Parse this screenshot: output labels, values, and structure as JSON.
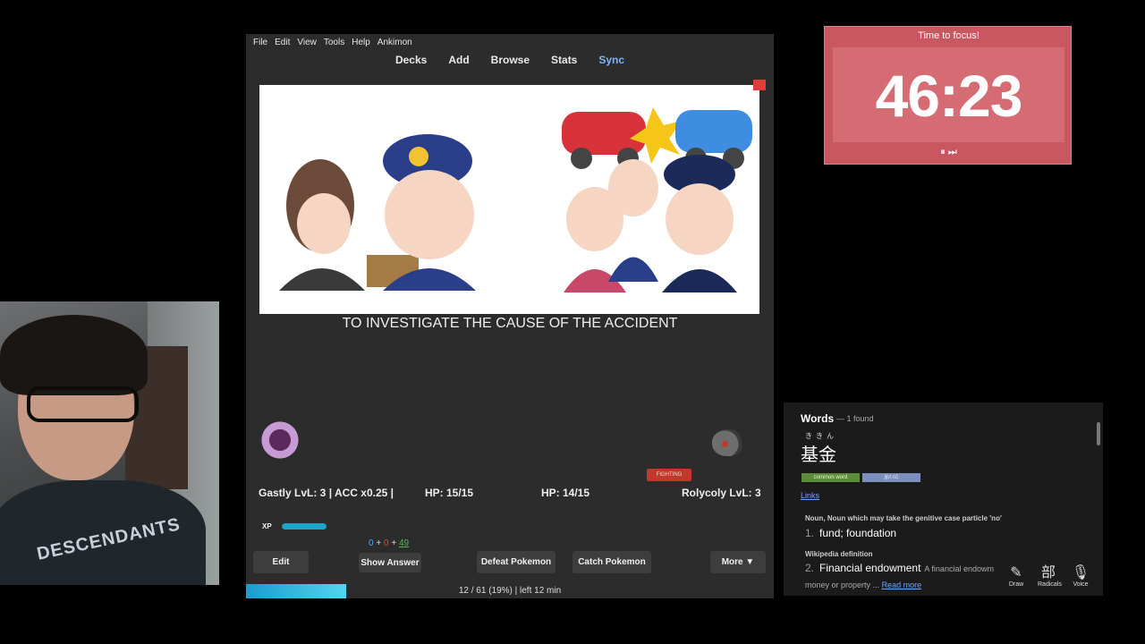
{
  "menubar": [
    "File",
    "Edit",
    "View",
    "Tools",
    "Help",
    "Ankimon"
  ],
  "toolbar": {
    "decks": "Decks",
    "add": "Add",
    "browse": "Browse",
    "stats": "Stats",
    "sync": "Sync"
  },
  "card": {
    "answer": "TO INVESTIGATE THE CAUSE OF THE ACCIDENT"
  },
  "battle": {
    "player": "Gastly LvL: 3 | ACC x0.25 |",
    "player_hp": "HP: 15/15",
    "enemy_hp": "HP: 14/15",
    "enemy": "Rolycoly LvL: 3",
    "enemy_type": "FIGHTING",
    "xp_label": "XP",
    "xp_fraction": 0.55
  },
  "counts": {
    "new": "0",
    "plus1": "+",
    "learn": "0",
    "plus2": "+",
    "review": "49"
  },
  "buttons": {
    "edit": "Edit",
    "show_answer": "Show Answer",
    "defeat": "Defeat Pokemon",
    "catch": "Catch Pokemon",
    "more": "More ▼"
  },
  "progress": {
    "text": "12 / 61 (19%) | left 12 min",
    "fraction": 0.19
  },
  "timer": {
    "title": "Time to focus!",
    "time": "46:23",
    "controls": "⏸ ⏭"
  },
  "dictionary": {
    "title": "Words",
    "count": "— 1 found",
    "furigana": "ききん",
    "word": "基金",
    "tags": [
      "common word",
      "jlpt n1"
    ],
    "links": "Links",
    "pos": "Noun, Noun which may take the genitive case particle 'no'",
    "def1_num": "1.",
    "def1": "fund; foundation",
    "wiki_header": "Wikipedia definition",
    "def2_num": "2.",
    "def2": "Financial endowment",
    "def2_extra": "A financial endowm",
    "def2_cont": "money or property ...",
    "read_more": "Read more",
    "tools": [
      {
        "icon": "✎",
        "label": "Draw"
      },
      {
        "icon": "部",
        "label": "Radicals"
      },
      {
        "icon": "🎙",
        "label": "Voice"
      }
    ]
  },
  "webcam": {
    "shirt_text": "DESCENDANTS"
  }
}
